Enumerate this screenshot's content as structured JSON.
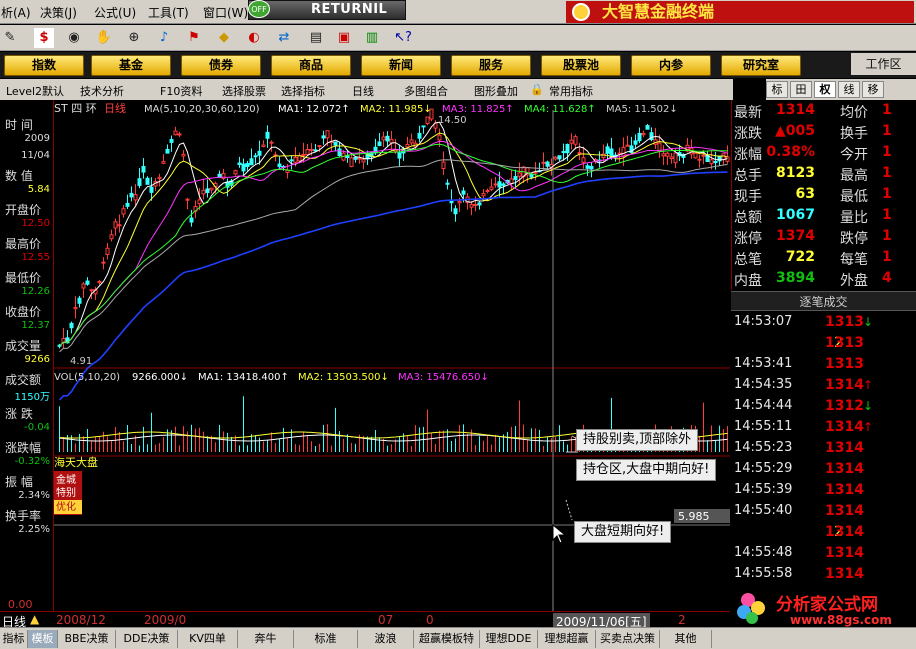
{
  "menu": {
    "items": [
      "析(A)",
      "决策(J)",
      "公式(U)",
      "工具(T)",
      "窗口(W)",
      "帮"
    ]
  },
  "returnil": {
    "badge": "OFF",
    "label": "RETURNIL"
  },
  "brand": {
    "title": "大智慧金融终端"
  },
  "nav": {
    "buttons": [
      "指数",
      "基金",
      "债券",
      "商品",
      "新闻",
      "服务",
      "股票池",
      "内参",
      "研究室"
    ],
    "workarea": "工作区"
  },
  "chartbar": {
    "items": [
      "Level2默认",
      "技术分析",
      "F10资料",
      "选择股票",
      "选择指标",
      "日线",
      "多图组合",
      "图形叠加",
      "常用指标"
    ]
  },
  "right_tabs": {
    "items": [
      "标",
      "田",
      "权",
      "线",
      "移"
    ]
  },
  "left_panel": {
    "time_label": "时 间",
    "year": "2009",
    "date": "11/04",
    "value_label": "数 值",
    "value": "5.84",
    "open_label": "开盘价",
    "open": "12.50",
    "high_label": "最高价",
    "high": "12.55",
    "low_label": "最低价",
    "low": "12.26",
    "close_label": "收盘价",
    "close": "12.37",
    "vol_label": "成交量",
    "vol": "9266",
    "amount_label": "成交额",
    "amount": "1150万",
    "change_label": "涨 跌",
    "change": "-0.04",
    "change_pct_label": "涨跌幅",
    "change_pct": "-0.32%",
    "amp_label": "振 幅",
    "amp": "2.34%",
    "turnover_label": "换手率",
    "turnover": "2.25%"
  },
  "chart_header": {
    "stock": "ST 四 环",
    "period": "日线",
    "ma_title": "MA(5,10,20,30,60,120)",
    "ma1": "MA1: 12.072↑",
    "ma2": "MA2: 11.985↓",
    "ma3": "MA3: 11.825↑",
    "ma4": "MA4: 11.628↑",
    "ma5": "MA5: 11.502↓"
  },
  "chart_labels": {
    "low_marker": "4.91",
    "high_marker": "14.50",
    "top_left_marker": "14.5",
    "vol_header": "VOL(5,10,20)",
    "vol_value": "9266.000↓",
    "vol_ma1": "MA1: 13418.400↑",
    "vol_ma2": "MA2: 13503.500↓",
    "vol_ma3": "MA3: 15476.650↓",
    "indicator_title": "海天大盘",
    "badge_lines": [
      "金城",
      "特别",
      "优化"
    ],
    "cursor_value": "5.985",
    "zero_label": "0.00"
  },
  "callouts": {
    "c1": "持股别卖,顶部除外",
    "c2": "持仓区,大盘中期向好!",
    "c3": "大盘短期向好!"
  },
  "quote": {
    "rows": [
      {
        "k1": "最新",
        "v1": "1314",
        "k2": "均价",
        "v2": "1"
      },
      {
        "k1": "涨跌",
        "v1": "▲005",
        "k2": "换手",
        "v2": "1"
      },
      {
        "k1": "涨幅",
        "v1": "0.38%",
        "k2": "今开",
        "v2": "1"
      },
      {
        "k1": "总手",
        "v1": "8123",
        "k2": "最高",
        "v2": "1"
      },
      {
        "k1": "现手",
        "v1": "63",
        "k2": "最低",
        "v2": "1"
      },
      {
        "k1": "总额",
        "v1": "1067",
        "k2": "量比",
        "v2": "1"
      },
      {
        "k1": "涨停",
        "v1": "1374",
        "k2": "跌停",
        "v2": "1"
      },
      {
        "k1": "总笔",
        "v1": "722",
        "k2": "每笔",
        "v2": "1"
      },
      {
        "k1": "内盘",
        "v1": "3894",
        "k2": "外盘",
        "v2": "4"
      }
    ],
    "colors": [
      "#e00000",
      "#e00000",
      "#e00000",
      "#ffff33",
      "#ffff33",
      "#33ffff",
      "#e00000",
      "#ffff33",
      "#10c010"
    ]
  },
  "trades": {
    "header": "逐笔成交",
    "rows": [
      {
        "time": "14:53:07",
        "price": "1313",
        "vol": "",
        "dir": "down"
      },
      {
        "time": "",
        "price": "1313",
        "vol": "2",
        "dir": ""
      },
      {
        "time": "14:53:41",
        "price": "1313",
        "vol": "",
        "dir": ""
      },
      {
        "time": "14:54:35",
        "price": "1314",
        "vol": "",
        "dir": "up"
      },
      {
        "time": "14:54:44",
        "price": "1312",
        "vol": "",
        "dir": "down"
      },
      {
        "time": "14:55:11",
        "price": "1314",
        "vol": "",
        "dir": "up"
      },
      {
        "time": "14:55:23",
        "price": "1314",
        "vol": "",
        "dir": ""
      },
      {
        "time": "14:55:29",
        "price": "1314",
        "vol": "",
        "dir": ""
      },
      {
        "time": "14:55:39",
        "price": "1314",
        "vol": "",
        "dir": ""
      },
      {
        "time": "14:55:40",
        "price": "1314",
        "vol": "",
        "dir": ""
      },
      {
        "time": "",
        "price": "1314",
        "vol": "2",
        "dir": ""
      },
      {
        "time": "14:55:48",
        "price": "1314",
        "vol": "",
        "dir": ""
      },
      {
        "time": "14:55:58",
        "price": "1314",
        "vol": "",
        "dir": ""
      }
    ]
  },
  "bottom_axis": {
    "period": "日线",
    "labels": [
      "2008/12",
      "2009/0",
      "07",
      "0",
      "2009/11/06[五]",
      "2"
    ]
  },
  "bottom_tabs": {
    "items": [
      "指标",
      "模板",
      "BBE决策",
      "DDE决策",
      "KV四单",
      "奔牛",
      "标准",
      "波浪",
      "超赢模板特",
      "理想DDE",
      "理想超赢",
      "买卖点决策",
      "其他"
    ]
  },
  "site": {
    "name": "分析家公式网",
    "url": "www.88gs.com"
  }
}
